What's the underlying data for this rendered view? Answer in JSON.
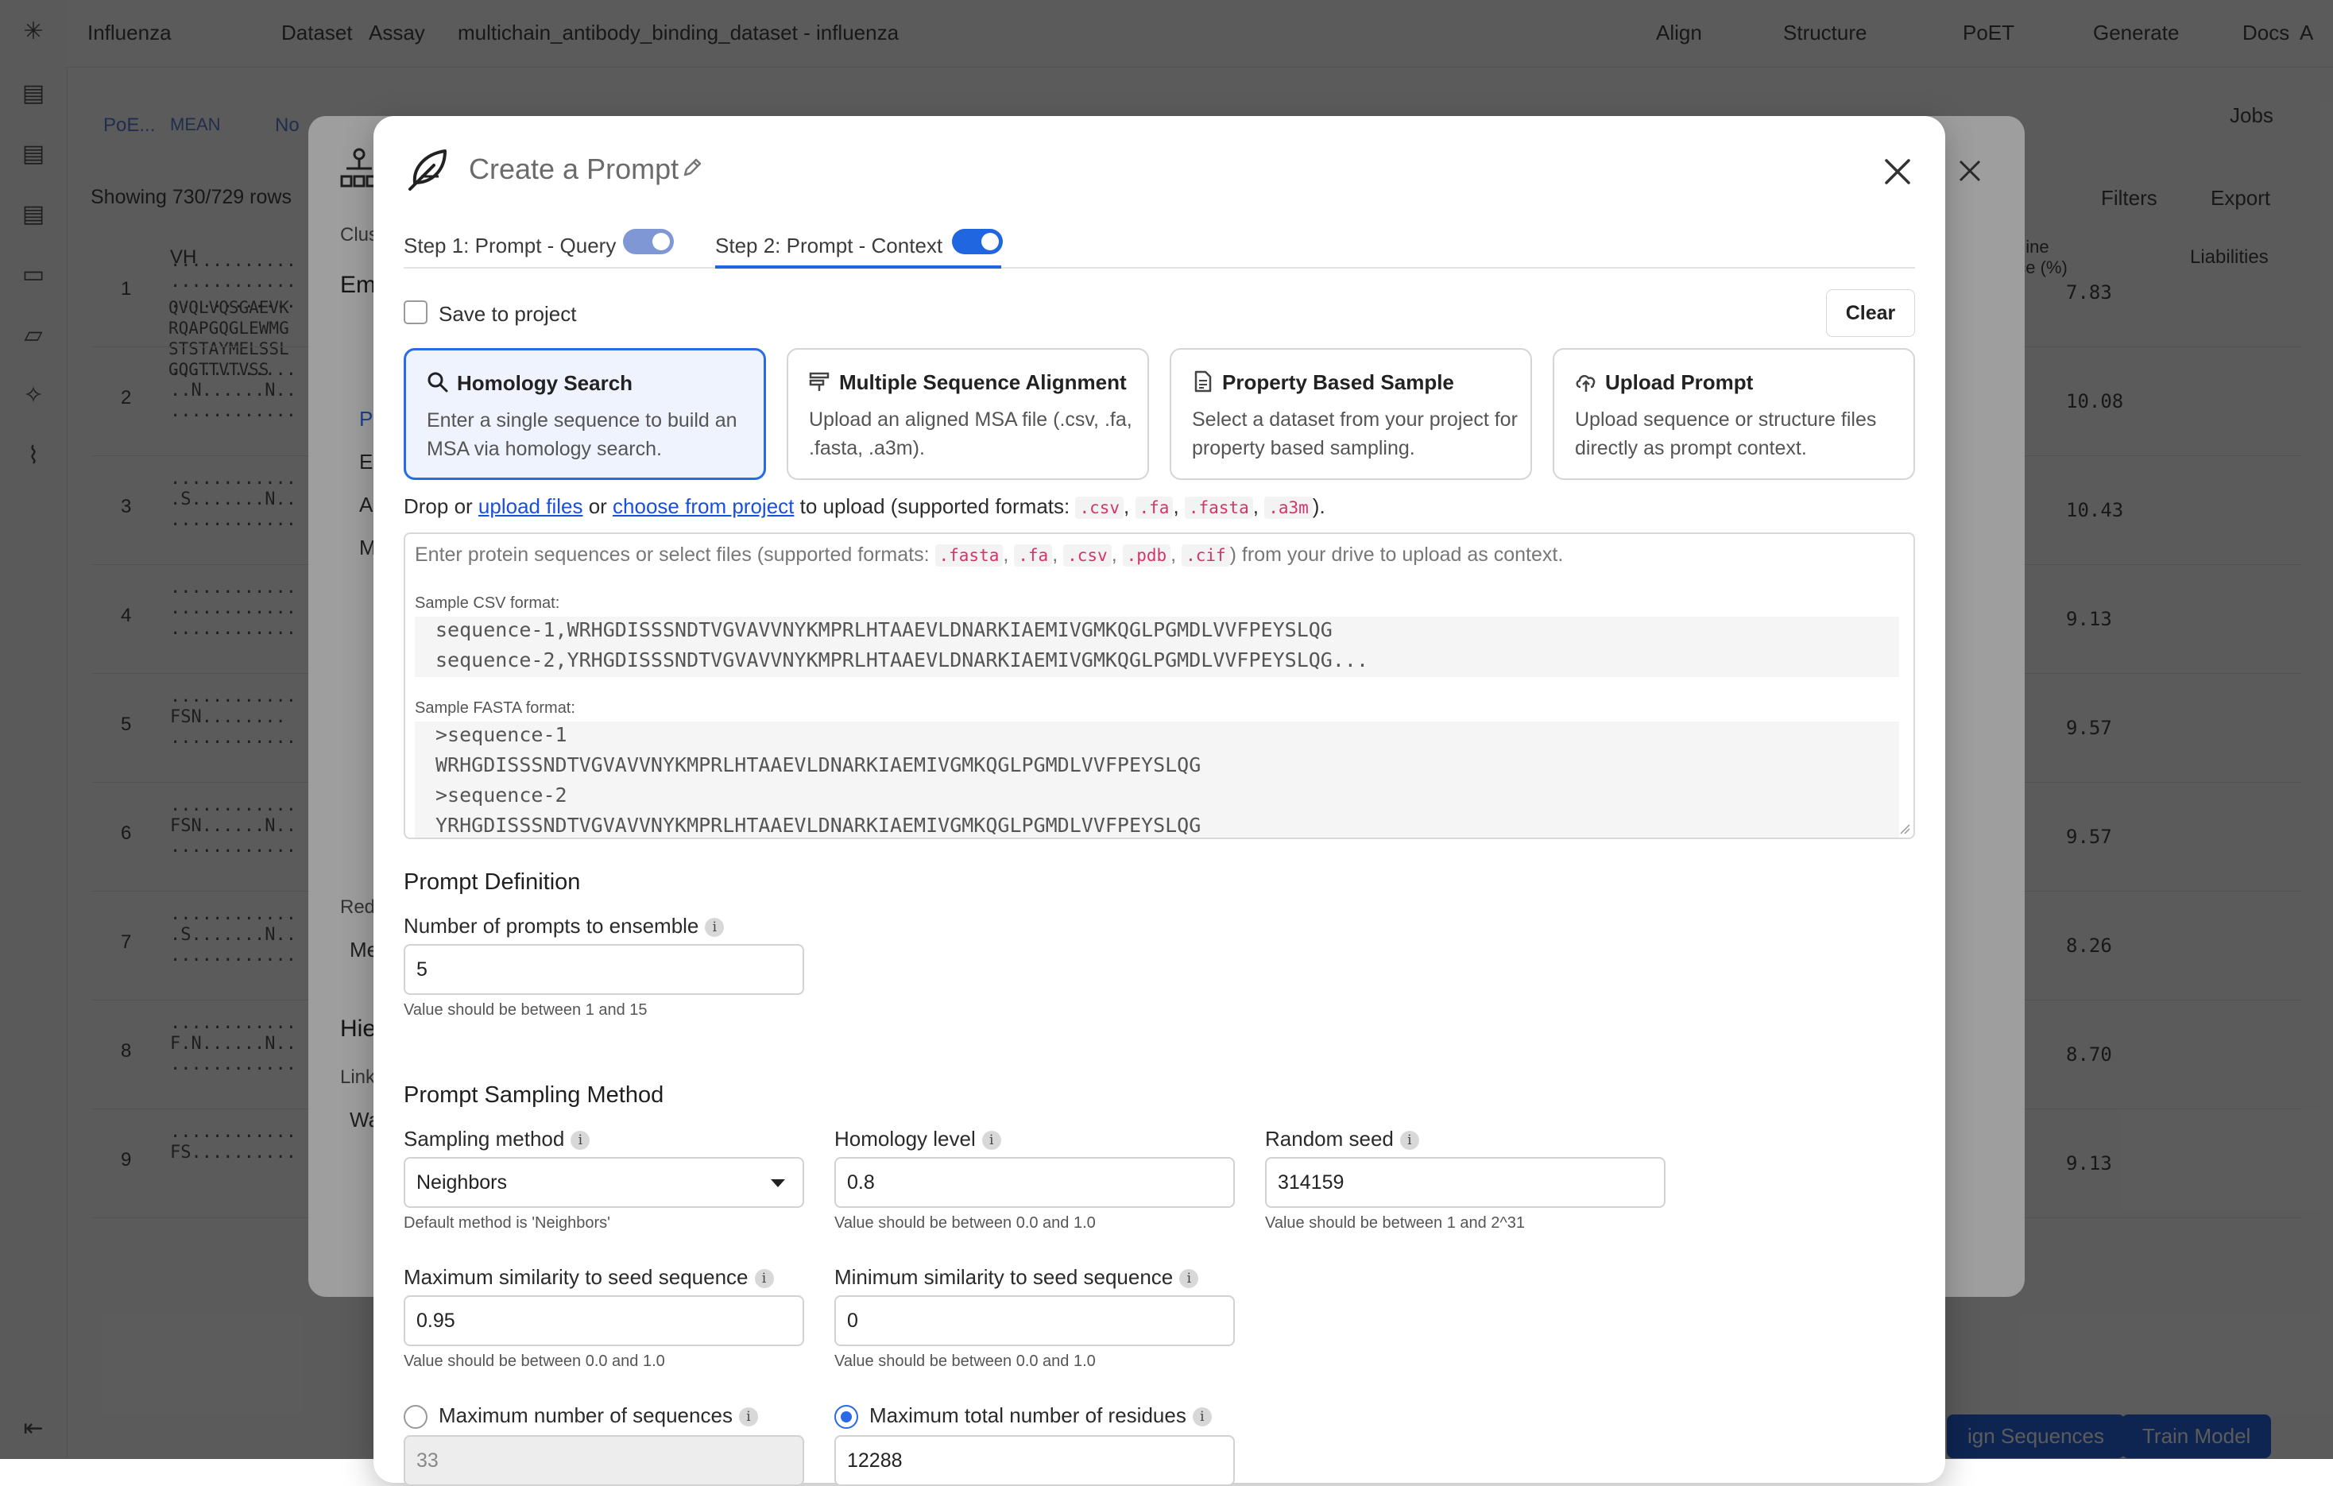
{
  "app": {
    "breadcrumb": [
      "Influenza",
      "Dataset",
      "Assay",
      "multichain_antibody_binding_dataset - influenza"
    ],
    "top_actions": [
      "Align",
      "Structure",
      "PoET",
      "Generate",
      "Docs"
    ],
    "avatar": "A",
    "jobs": "Jobs",
    "showing_rows": "Showing 730/729 rows",
    "column_vh": "VH",
    "column_liabilities": "Liabilities",
    "column_humanness": "mline\nnce (%)",
    "filters": "Filters",
    "export": "Export",
    "chip_poe": "PoE...",
    "chip_mean": "MEAN",
    "chip_no": "No",
    "bottom_buttons": [
      "ign Sequences",
      "Train Model"
    ],
    "rows": [
      {
        "idx": "1",
        "seq": "............\n............\n............",
        "val": "7.83"
      },
      {
        "idx": "2",
        "seq": "............\n..N......N..\n............",
        "val": "10.08"
      },
      {
        "idx": "3",
        "seq": "............\n.S.......N..\n............",
        "val": "10.43"
      },
      {
        "idx": "4",
        "seq": "............\n............\n............",
        "val": "9.13"
      },
      {
        "idx": "5",
        "seq": "............\nFSN........\n............",
        "val": "9.57"
      },
      {
        "idx": "6",
        "seq": "............\nFSN......N..\n............",
        "val": "9.57"
      },
      {
        "idx": "7",
        "seq": "............\n.S.......N..\n............",
        "val": "8.26"
      },
      {
        "idx": "8",
        "seq": "............\nF.N......N..\n............",
        "val": "8.70"
      },
      {
        "idx": "9",
        "seq": "............\nFS..........",
        "val": "9.13"
      }
    ],
    "first_seq": "QVQLVQSGAEVK\nRQAPGQGLEWMG\nSTSTAYMELSSL\nGQGTTVTVSS"
  },
  "behind_modal": {
    "left_labels": [
      "Clus",
      "Em",
      "Red",
      "Me",
      "Hie",
      "Link",
      "Wa"
    ],
    "menu_letters": [
      "P",
      "E",
      "A",
      "M"
    ]
  },
  "modal": {
    "title": "Create a Prompt",
    "steps": [
      {
        "label": "Step 1: Prompt - Query",
        "enabled": true
      },
      {
        "label": "Step 2: Prompt - Context",
        "enabled": true
      }
    ],
    "save_to_project": "Save to project",
    "clear": "Clear",
    "cards": [
      {
        "title": "Homology Search",
        "desc": "Enter a single sequence to build an MSA via homology search.",
        "icon": "search-icon",
        "selected": true
      },
      {
        "title": "Multiple Sequence Alignment",
        "desc": "Upload an aligned MSA file (.csv, .fa, .fasta, .a3m).",
        "icon": "alignment-icon",
        "selected": false
      },
      {
        "title": "Property Based Sample",
        "desc": "Select a dataset from your project for property based sampling.",
        "icon": "document-icon",
        "selected": false
      },
      {
        "title": "Upload Prompt",
        "desc": "Upload sequence or structure files directly as prompt context.",
        "icon": "cloud-upload-icon",
        "selected": false
      }
    ],
    "drop": {
      "prefix": "Drop or ",
      "upload_link": "upload files",
      "or": " or ",
      "choose_link": "choose from project",
      "suffix": " to upload (supported formats: ",
      "formats": [
        ".csv",
        ".fa",
        ".fasta",
        ".a3m"
      ],
      "end": ")."
    },
    "textarea": {
      "placeholder_prefix": "Enter protein sequences or select files (supported formats: ",
      "formats": [
        ".fasta",
        ".fa",
        ".csv",
        ".pdb",
        ".cif"
      ],
      "placeholder_suffix": ") from your drive to upload as context.",
      "csv_label": "Sample CSV format:",
      "csv_lines": [
        "sequence-1,WRHGDISSSNDTVGVAVVNYKMPRLHTAAEVLDNARKIAEMIVGMKQGLPGMDLVVFPEYSLQG",
        "sequence-2,YRHGDISSSNDTVGVAVVNYKMPRLHTAAEVLDNARKIAEMIVGMKQGLPGMDLVVFPEYSLQG..."
      ],
      "fasta_label": "Sample FASTA format:",
      "fasta_lines": [
        ">sequence-1",
        "WRHGDISSSNDTVGVAVVNYKMPRLHTAAEVLDNARKIAEMIVGMKQGLPGMDLVVFPEYSLQG",
        ">sequence-2",
        "YRHGDISSSNDTVGVAVVNYKMPRLHTAAEVLDNARKIAEMIVGMKQGLPGMDLVVFPEYSLQG"
      ]
    },
    "prompt_definition": {
      "title": "Prompt Definition",
      "num_prompts_label": "Number of prompts to ensemble",
      "num_prompts_value": "5",
      "num_prompts_hint": "Value should be between 1 and 15"
    },
    "sampling": {
      "title": "Prompt Sampling Method",
      "method_label": "Sampling method",
      "method_value": "Neighbors",
      "method_hint": "Default method is 'Neighbors'",
      "homology_label": "Homology level",
      "homology_value": "0.8",
      "homology_hint": "Value should be between 0.0 and 1.0",
      "seed_label": "Random seed",
      "seed_value": "314159",
      "seed_hint": "Value should be between 1 and 2^31",
      "max_sim_label": "Maximum similarity to seed sequence",
      "max_sim_value": "0.95",
      "max_sim_hint": "Value should be between 0.0 and 1.0",
      "min_sim_label": "Minimum similarity to seed sequence",
      "min_sim_value": "0",
      "min_sim_hint": "Value should be between 0.0 and 1.0",
      "max_seqs_label": "Maximum number of sequences",
      "max_seqs_value": "33",
      "max_seqs_selected": false,
      "max_res_label": "Maximum total number of residues",
      "max_res_value": "12288",
      "max_res_selected": true
    }
  },
  "colors": {
    "accent": "#1f66e0",
    "selected_card_bg": "#eef3fd",
    "code_pink": "#d6336c",
    "link": "#1a4fd8"
  }
}
